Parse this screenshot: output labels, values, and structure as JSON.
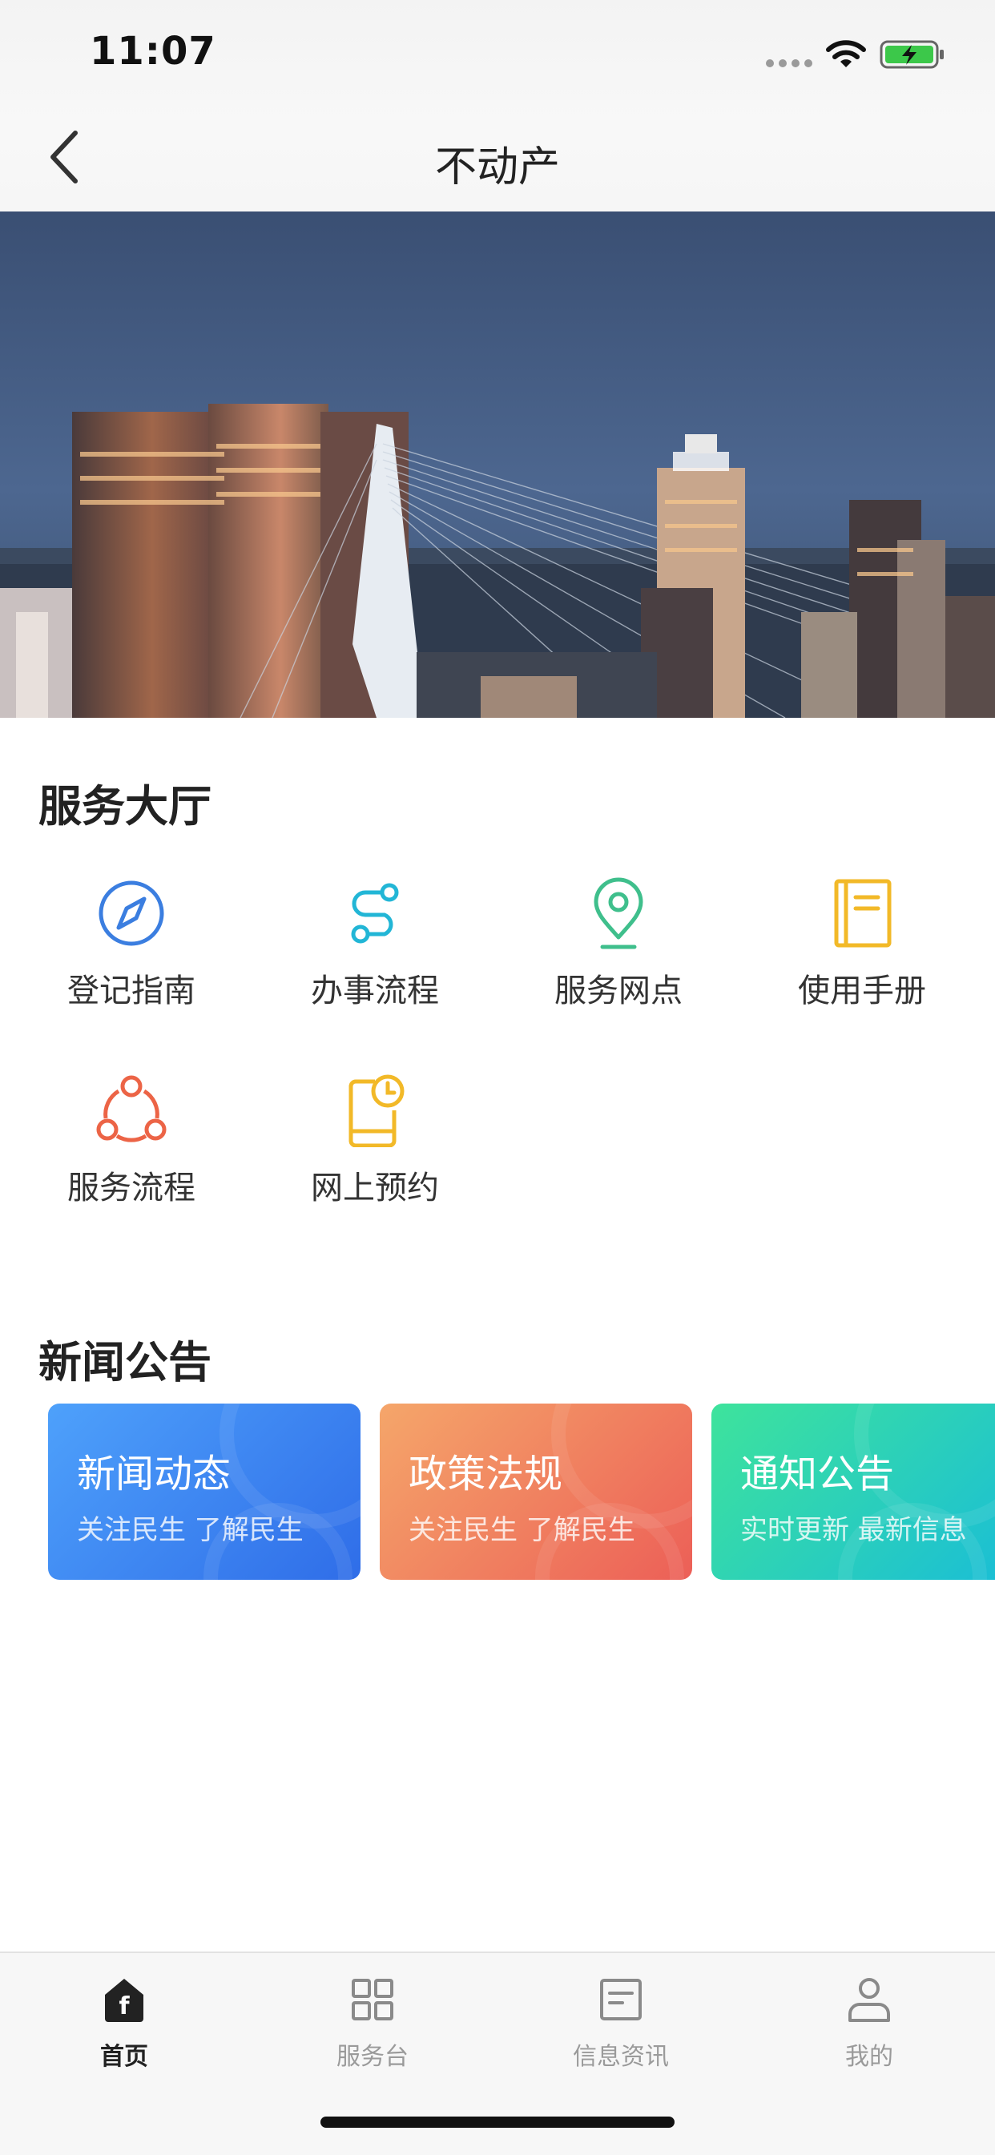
{
  "status_bar": {
    "time": "11:07"
  },
  "nav": {
    "title": "不动产",
    "back_icon": "chevron-left-icon"
  },
  "banner": {
    "image": "city-skyline-dusk"
  },
  "service_hall": {
    "title": "服务大厅",
    "items": [
      {
        "label": "登记指南",
        "icon": "compass-icon",
        "color": "#3b7ee0"
      },
      {
        "label": "办事流程",
        "icon": "route-icon",
        "color": "#22b6d6"
      },
      {
        "label": "服务网点",
        "icon": "location-pin-icon",
        "color": "#3fbf8c"
      },
      {
        "label": "使用手册",
        "icon": "book-icon",
        "color": "#f2b928"
      },
      {
        "label": "服务流程",
        "icon": "share-nodes-icon",
        "color": "#ec6446"
      },
      {
        "label": "网上预约",
        "icon": "phone-clock-icon",
        "color": "#f2b928"
      }
    ]
  },
  "news": {
    "title": "新闻公告",
    "cards": [
      {
        "title": "新闻动态",
        "subtitle": "关注民生 了解民生"
      },
      {
        "title": "政策法规",
        "subtitle": "关注民生 了解民生"
      },
      {
        "title": "通知公告",
        "subtitle": "实时更新 最新信息"
      }
    ]
  },
  "tabbar": {
    "tabs": [
      {
        "label": "首页",
        "icon": "home-icon",
        "active": true
      },
      {
        "label": "服务台",
        "icon": "grid-icon",
        "active": false
      },
      {
        "label": "信息资讯",
        "icon": "news-icon",
        "active": false
      },
      {
        "label": "我的",
        "icon": "user-icon",
        "active": false
      }
    ]
  }
}
